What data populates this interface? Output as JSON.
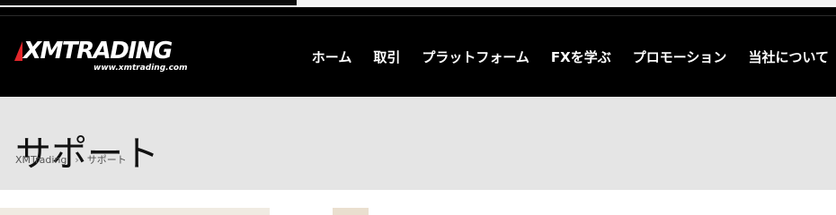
{
  "brand": {
    "logo_text": "XMTRADING",
    "logo_url_text": "www.xmtrading.com",
    "accent_color": "#e3262b"
  },
  "nav": {
    "items": [
      {
        "label": "ホーム"
      },
      {
        "label": "取引"
      },
      {
        "label": "プラットフォーム"
      },
      {
        "label": "FXを学ぶ"
      },
      {
        "label": "プロモーション"
      },
      {
        "label": "当社について"
      }
    ]
  },
  "page": {
    "title": "サポート",
    "breadcrumb": {
      "home": "XMTrading",
      "separator": "›",
      "current": "サポート"
    }
  },
  "colors": {
    "header_bg": "#000000",
    "title_band_bg": "#e5e5e5",
    "text_light": "#ffffff"
  },
  "icons": {
    "logo_mark": "red-triangle-mark"
  }
}
